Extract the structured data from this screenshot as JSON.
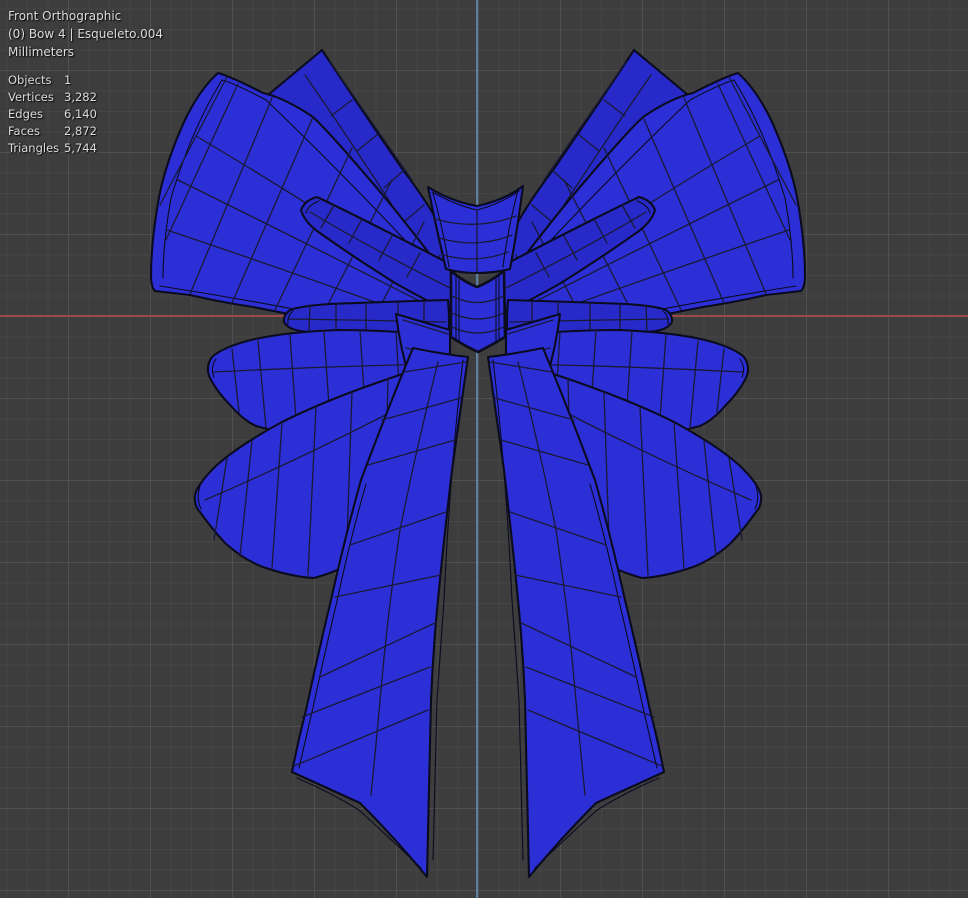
{
  "viewport": {
    "view_label": "Front Orthographic",
    "object_label": "(0) Bow 4 | Esqueleto.004",
    "units_label": "Millimeters"
  },
  "stats": {
    "rows": [
      {
        "label": "Objects",
        "value": "1"
      },
      {
        "label": "Vertices",
        "value": "3,282"
      },
      {
        "label": "Edges",
        "value": "6,140"
      },
      {
        "label": "Faces",
        "value": "2,872"
      },
      {
        "label": "Triangles",
        "value": "5,744"
      }
    ]
  },
  "colors": {
    "background": "#3d3d3d",
    "grid_minor": "#454545",
    "grid_major": "#505050",
    "axis_x": "#ad4a4a",
    "axis_z": "#6390bd",
    "bow_fill": "#2c2fd6",
    "bow_fill_dark": "#272ac8",
    "wire": "#0b0b20",
    "wire_soft": "#191936",
    "text": "#dcdcdc"
  }
}
